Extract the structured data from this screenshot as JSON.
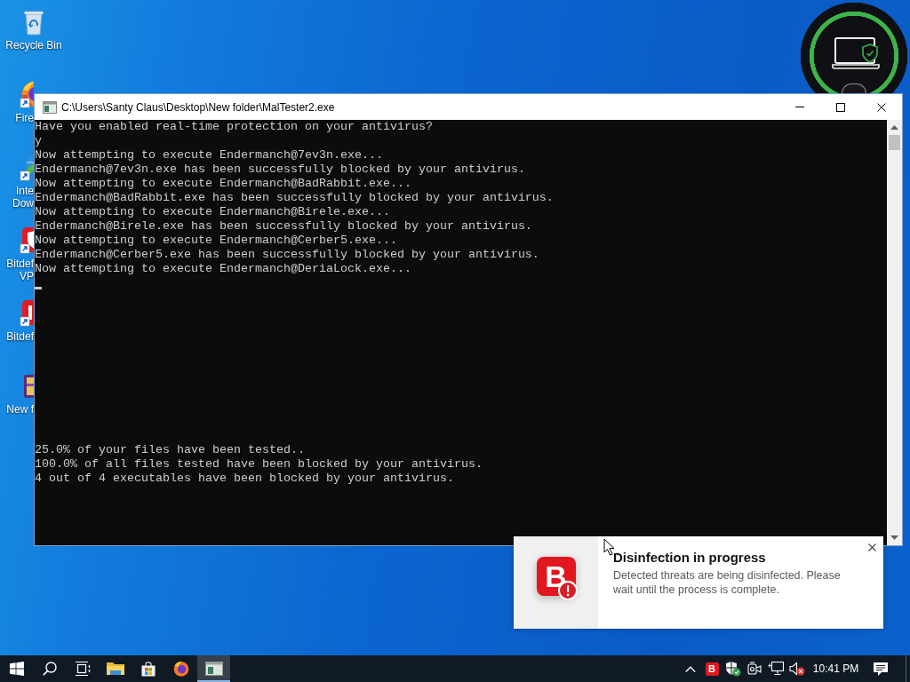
{
  "desktop": {
    "icons": [
      {
        "kind": "recycle",
        "label": [
          "Recycle Bin"
        ],
        "clipped": false
      },
      {
        "kind": "browser",
        "label": [
          "Fire"
        ],
        "clipped": true
      },
      {
        "kind": "downloader",
        "label": [
          "Inte",
          "Dow"
        ],
        "clipped": true
      },
      {
        "kind": "vpn",
        "label": [
          "Bitdef",
          "VP"
        ],
        "clipped": true
      },
      {
        "kind": "antivirus",
        "label": [
          "Bitdef"
        ],
        "clipped": true
      },
      {
        "kind": "archive",
        "label": [
          "New f"
        ],
        "clipped": true
      }
    ]
  },
  "console_window": {
    "title": "C:\\Users\\Santy Claus\\Desktop\\New folder\\MalTester2.exe",
    "output": [
      "Have you enabled real-time protection on your antivirus?",
      "y",
      "Now attempting to execute Endermanch@7ev3n.exe...",
      "Endermanch@7ev3n.exe has been successfully blocked by your antivirus.",
      "Now attempting to execute Endermanch@BadRabbit.exe...",
      "Endermanch@BadRabbit.exe has been successfully blocked by your antivirus.",
      "Now attempting to execute Endermanch@Birele.exe...",
      "Endermanch@Birele.exe has been successfully blocked by your antivirus.",
      "Now attempting to execute Endermanch@Cerber5.exe...",
      "Endermanch@Cerber5.exe has been successfully blocked by your antivirus.",
      "Now attempting to execute Endermanch@DeriaLock.exe..."
    ],
    "summary": [
      "25.0% of your files have been tested..",
      "100.0% of all files tested have been blocked by your antivirus.",
      "4 out of 4 executables have been blocked by your antivirus."
    ]
  },
  "notification": {
    "app_letter": "B",
    "title": "Disinfection in progress",
    "body": "Detected threats are being disinfected. Please wait until the process is complete."
  },
  "taskbar": {
    "buttons": [
      {
        "kind": "start",
        "selected": false
      },
      {
        "kind": "search",
        "selected": false
      },
      {
        "kind": "taskview",
        "selected": false
      },
      {
        "kind": "explorer",
        "selected": false
      },
      {
        "kind": "store",
        "selected": false
      },
      {
        "kind": "browser",
        "selected": false
      },
      {
        "kind": "console",
        "selected": true
      }
    ],
    "tray": [
      {
        "kind": "chevron"
      },
      {
        "kind": "antivirus",
        "letter": "B"
      },
      {
        "kind": "security"
      },
      {
        "kind": "meet"
      },
      {
        "kind": "network"
      },
      {
        "kind": "volume",
        "muted": true
      }
    ],
    "clock": "10:41 PM"
  }
}
